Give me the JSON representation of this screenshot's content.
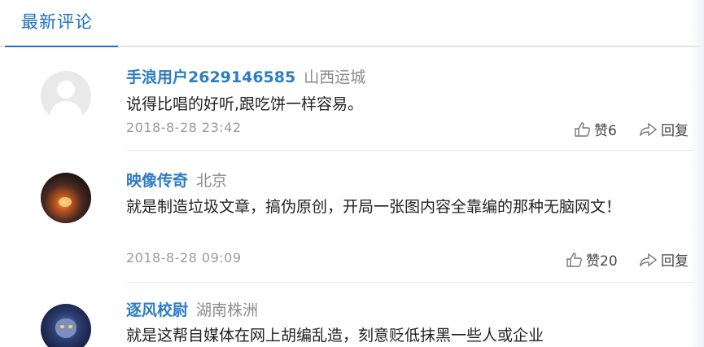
{
  "header": {
    "title": "最新评论"
  },
  "actions": {
    "reply_label": "回复"
  },
  "comments": [
    {
      "user": "手浪用户2629146585",
      "location": "山西运城",
      "text": "说得比唱的好听,跟吃饼一样容易。",
      "time": "2018-8-28 23:42",
      "likes": "赞6",
      "avatar": "default-avatar"
    },
    {
      "user": "映像传奇",
      "location": "北京",
      "text": "就是制造垃圾文章，搞伪原创，开局一张图内容全靠编的那种无脑网文！",
      "time": "2018-8-28 09:09",
      "likes": "赞20",
      "avatar": "fire-photo-avatar"
    },
    {
      "user": "逐风校尉",
      "location": "湖南株洲",
      "text": "就是这帮自媒体在网上胡编乱造，刻意贬低抹黑一些人或企业",
      "avatar": "game-character-avatar"
    }
  ]
}
